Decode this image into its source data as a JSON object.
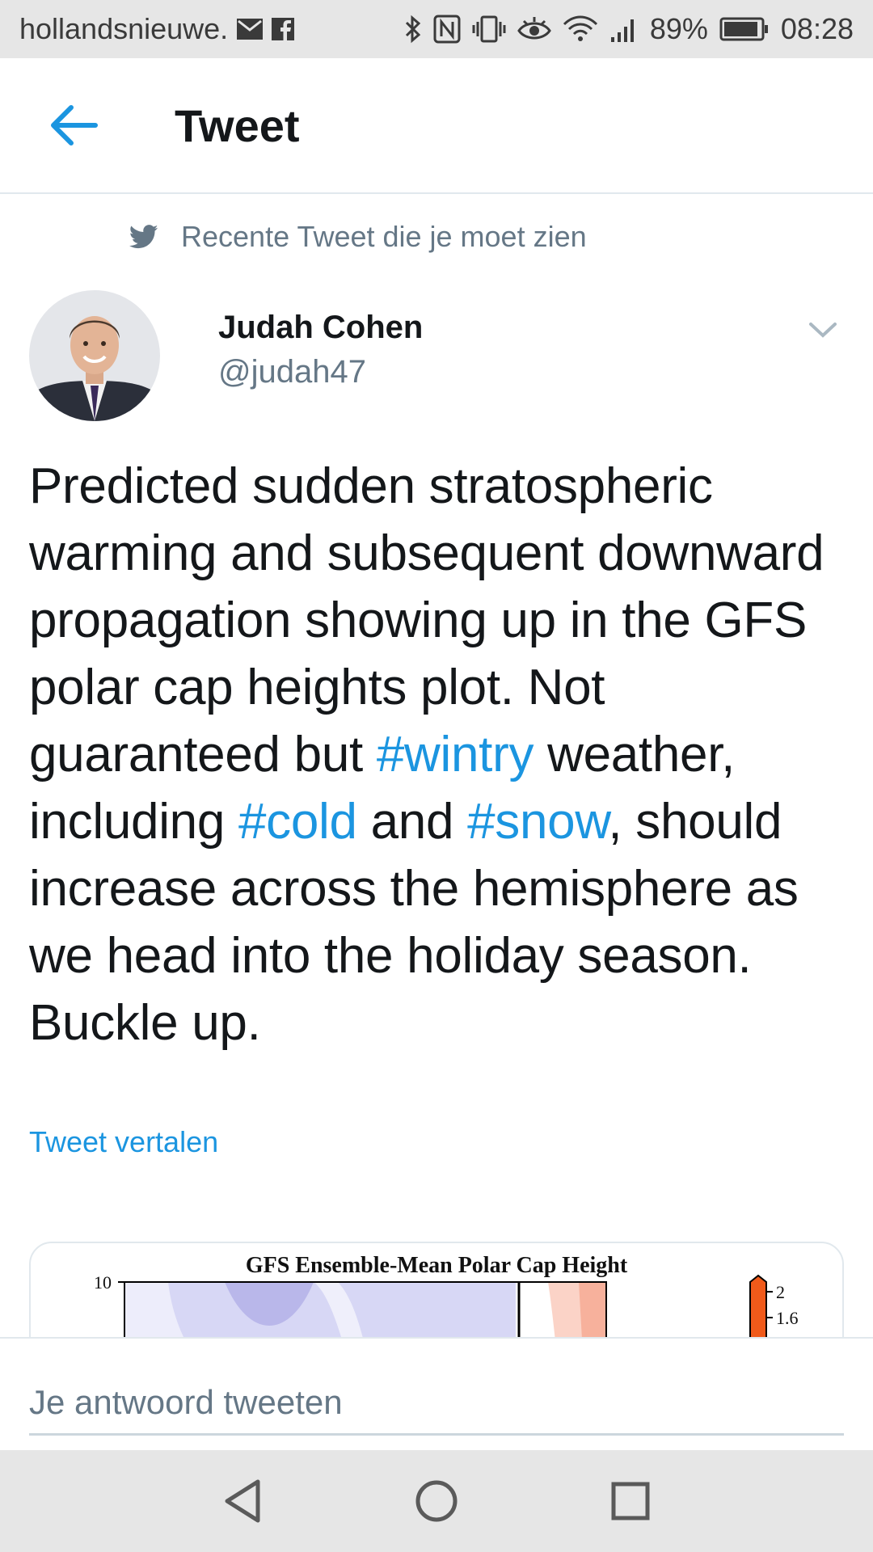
{
  "status_bar": {
    "carrier": "hollandsnieuwe.",
    "battery": "89%",
    "time": "08:28",
    "icons": [
      "mail-icon",
      "facebook-icon",
      "bluetooth-icon",
      "nfc-icon",
      "vibrate-icon",
      "eye-icon",
      "wifi-icon",
      "signal-icon",
      "battery-icon"
    ]
  },
  "header": {
    "back_icon": "arrow-left-icon",
    "title": "Tweet"
  },
  "tweet": {
    "social_context": "Recente Tweet die je moet zien",
    "author": {
      "name": "Judah Cohen",
      "handle": "@judah47"
    },
    "text": {
      "part1": "Predicted sudden stratospheric warming and subsequent downward propagation showing up in the GFS polar cap heights plot. Not guaranteed but ",
      "hashtag1": "#wintry",
      "part2": " weather, including ",
      "hashtag2": "#cold",
      "part3": " and ",
      "hashtag3": "#snow",
      "part4": ", should increase across the hemisphere as we head into the holiday season. Buckle up."
    },
    "translate_label": "Tweet vertalen"
  },
  "media": {
    "chart_title": "GFS Ensemble-Mean Polar Cap Height",
    "y_tick_top": "10",
    "colorbar_labels": [
      "2",
      "1.6"
    ]
  },
  "reply": {
    "placeholder": "Je antwoord tweeten"
  },
  "nav": {
    "back": "triangle-back-icon",
    "home": "circle-home-icon",
    "recents": "square-recents-icon"
  },
  "colors": {
    "accent": "#1b95e0",
    "secondary_text": "#657786",
    "divider": "#e1e8ed"
  }
}
